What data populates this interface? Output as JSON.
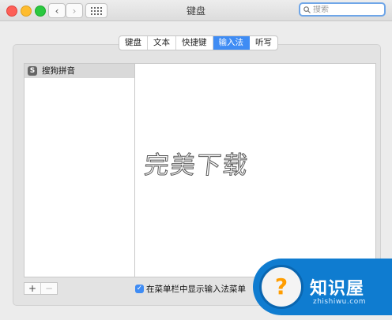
{
  "window": {
    "title": "键盘"
  },
  "search": {
    "placeholder": "搜索"
  },
  "tabs": [
    {
      "label": "键盘",
      "active": false
    },
    {
      "label": "文本",
      "active": false
    },
    {
      "label": "快捷键",
      "active": false
    },
    {
      "label": "输入法",
      "active": true
    },
    {
      "label": "听写",
      "active": false
    }
  ],
  "sources": {
    "items": [
      {
        "label": "搜狗拼音",
        "icon_text": "S",
        "selected": true
      }
    ]
  },
  "watermark": {
    "text": "完美下载"
  },
  "buttons": {
    "add": "+",
    "remove": "−"
  },
  "show_menu": {
    "label": "在菜单栏中显示输入法菜单",
    "checked": true,
    "check_glyph": "✓"
  },
  "logo": {
    "title": "知识屋",
    "url": "zhishiwu.com",
    "icon_text": "?"
  },
  "colors": {
    "accent": "#3f8cf4",
    "logo_blue": "#0f7cd0",
    "logo_orange": "#ff9d00"
  }
}
